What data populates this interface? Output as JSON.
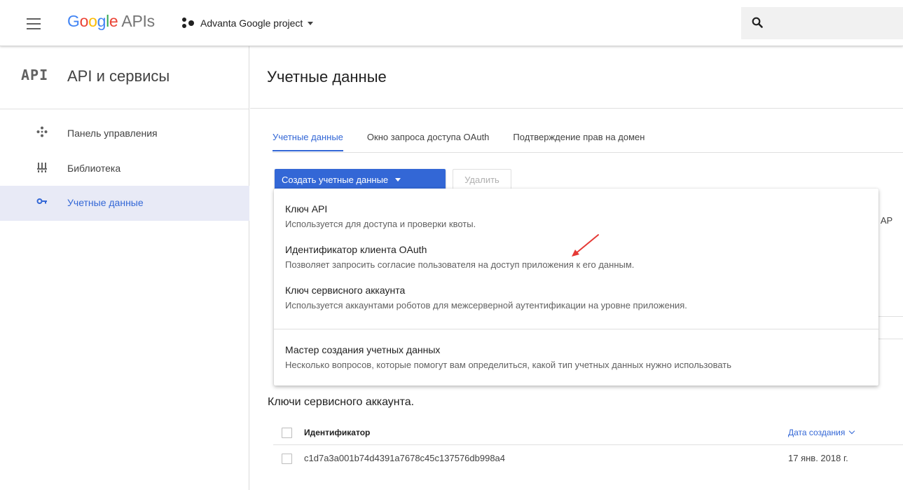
{
  "topbar": {
    "logo_google": [
      "G",
      "o",
      "o",
      "g",
      "l",
      "e"
    ],
    "logo_apis": "APIs",
    "project_name": "Advanta Google project"
  },
  "sidebar": {
    "badge": "API",
    "title": "API и сервисы",
    "items": [
      {
        "label": "Панель управления",
        "icon": "dashboard-icon",
        "active": false
      },
      {
        "label": "Библиотека",
        "icon": "library-icon",
        "active": false
      },
      {
        "label": "Учетные данные",
        "icon": "key-icon",
        "active": true
      }
    ]
  },
  "main": {
    "title": "Учетные данные",
    "tabs": [
      {
        "label": "Учетные данные",
        "active": true
      },
      {
        "label": "Окно запроса доступа OAuth",
        "active": false
      },
      {
        "label": "Подтверждение прав на домен",
        "active": false
      }
    ],
    "create_button": "Создать учетные данные",
    "delete_button": "Удалить",
    "peek_text": "по АР",
    "menu": [
      {
        "title": "Ключ API",
        "desc": "Используется для доступа и проверки квоты."
      },
      {
        "title": "Идентификатор клиента OAuth",
        "desc": "Позволяет запросить согласие пользователя на доступ приложения к его данным."
      },
      {
        "title": "Ключ сервисного аккаунта",
        "desc": "Используется аккаунтами роботов для межсерверной аутентификации на уровне приложения."
      },
      {
        "title": "Мастер создания учетных данных",
        "desc": "Несколько вопросов, которые помогут вам определиться, какой тип учетных данных нужно использовать"
      }
    ],
    "service_accounts": {
      "title": "Ключи сервисного аккаунта.",
      "headers": {
        "id": "Идентификатор",
        "created": "Дата создания"
      },
      "rows": [
        {
          "id": "c1d7a3a001b74d4391a7678c45c137576db998a4",
          "created": "17 янв. 2018 г."
        }
      ]
    }
  },
  "colors": {
    "accent": "#3367d6",
    "arrow": "#e53935"
  }
}
